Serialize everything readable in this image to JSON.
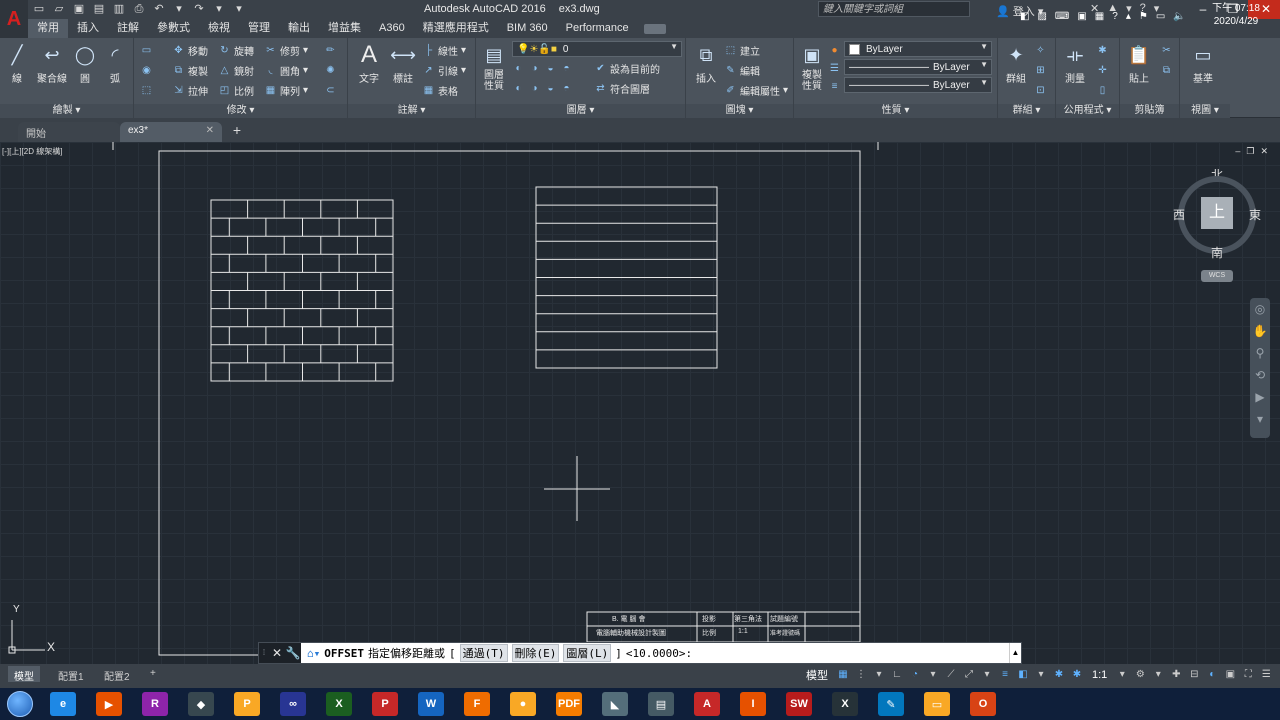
{
  "title_bar": {
    "app_name": "Autodesk AutoCAD 2016",
    "file_name": "ex3.dwg",
    "search_placeholder": "鍵入關鍵字或詞組",
    "login_label": "登入",
    "logo_letter": "A"
  },
  "ribbon_tabs": [
    "常用",
    "插入",
    "註解",
    "參數式",
    "檢視",
    "管理",
    "輸出",
    "增益集",
    "A360",
    "精選應用程式",
    "BIM 360",
    "Performance"
  ],
  "ribbon": {
    "draw": {
      "title": "繪製",
      "line": "線",
      "polyline": "聚合線",
      "circle": "圓",
      "arc": "弧"
    },
    "modify": {
      "title": "修改",
      "move": "移動",
      "rotate": "旋轉",
      "trim": "修剪",
      "copy": "複製",
      "mirror": "鏡射",
      "fillet": "圓角",
      "stretch": "拉伸",
      "scale": "比例",
      "array": "陣列"
    },
    "annotation": {
      "title": "註解",
      "text": "文字",
      "dimension": "標註",
      "linear": "線性",
      "leader": "引線",
      "table": "表格"
    },
    "layers": {
      "title": "圖層",
      "properties": "圖層\n性質",
      "current_layer": "0",
      "make_current": "設為目前的",
      "match_layer": "符合圖層"
    },
    "block": {
      "title": "圖塊",
      "insert": "插入",
      "create": "建立",
      "edit": "編輯",
      "edit_attributes": "編輯屬性"
    },
    "properties": {
      "title": "性質",
      "match": "複製\n性質",
      "color": "ByLayer",
      "linetype": "ByLayer",
      "lineweight": "ByLayer"
    },
    "groups": {
      "title": "群組",
      "group": "群組"
    },
    "utilities": {
      "title": "公用程式",
      "measure": "測量"
    },
    "clipboard": {
      "title": "剪貼簿",
      "paste": "貼上"
    },
    "view": {
      "title": "視圖",
      "base": "基準"
    }
  },
  "doc_tabs": {
    "start": "開始",
    "current": "ex3*"
  },
  "viewport": {
    "label": "[-][上][2D 線架構]"
  },
  "viewcube": {
    "face": "上",
    "north": "北",
    "south": "南",
    "east": "東",
    "west": "西",
    "wcs": "WCS"
  },
  "ucs": {
    "x": "X",
    "y": "Y"
  },
  "title_block": {
    "r1c1": "B.  電  腦  會",
    "r1c2": "投影",
    "r1c3": "第三角法",
    "r1c4": "試題編號",
    "r2c1": "電腦輔助機械設計製圖",
    "r2c2": "比例",
    "r2c3": "1:1",
    "r2c4": "准考證號碼"
  },
  "command_line": {
    "command": "OFFSET",
    "prompt": "指定偏移距離或",
    "open_bracket": "[",
    "opt_through": "通過(T)",
    "opt_erase": "刪除(E)",
    "opt_layer": "圖層(L)",
    "close_bracket": "]",
    "default_value": "<10.0000>:"
  },
  "layout_tabs": [
    "模型",
    "配置1",
    "配置2"
  ],
  "status": {
    "space": "模型",
    "scale": "1:1"
  },
  "taskbar": {
    "time": "下午 07:18",
    "date": "2020/4/29",
    "apps": [
      {
        "name": "ie",
        "label": "e",
        "color": "#1e88e5"
      },
      {
        "name": "media-player",
        "label": "▶",
        "color": "#e65100"
      },
      {
        "name": "winrar",
        "label": "R",
        "color": "#8e24aa"
      },
      {
        "name": "inkscape",
        "label": "◆",
        "color": "#37474f"
      },
      {
        "name": "player",
        "label": "P",
        "color": "#f9a825"
      },
      {
        "name": "app-blue",
        "label": "∞",
        "color": "#283593"
      },
      {
        "name": "excel",
        "label": "X",
        "color": "#1b5e20"
      },
      {
        "name": "powerpoint",
        "label": "P",
        "color": "#c62828"
      },
      {
        "name": "word",
        "label": "W",
        "color": "#1565c0"
      },
      {
        "name": "firefox",
        "label": "F",
        "color": "#ef6c00"
      },
      {
        "name": "chrome",
        "label": "●",
        "color": "#f9a825"
      },
      {
        "name": "pdf",
        "label": "PDF",
        "color": "#f57c00"
      },
      {
        "name": "inventor",
        "label": "◣",
        "color": "#546e7a"
      },
      {
        "name": "app-eng",
        "label": "▤",
        "color": "#455a64"
      },
      {
        "name": "autocad",
        "label": "A",
        "color": "#c62828"
      },
      {
        "name": "inventor-i",
        "label": "I",
        "color": "#e65100"
      },
      {
        "name": "solidworks",
        "label": "SW",
        "color": "#b71c1c"
      },
      {
        "name": "x9",
        "label": "X",
        "color": "#263238"
      },
      {
        "name": "paint",
        "label": "✎",
        "color": "#0277bd"
      },
      {
        "name": "explorer",
        "label": "▭",
        "color": "#f9a825"
      },
      {
        "name": "office",
        "label": "O",
        "color": "#d84315"
      }
    ]
  }
}
